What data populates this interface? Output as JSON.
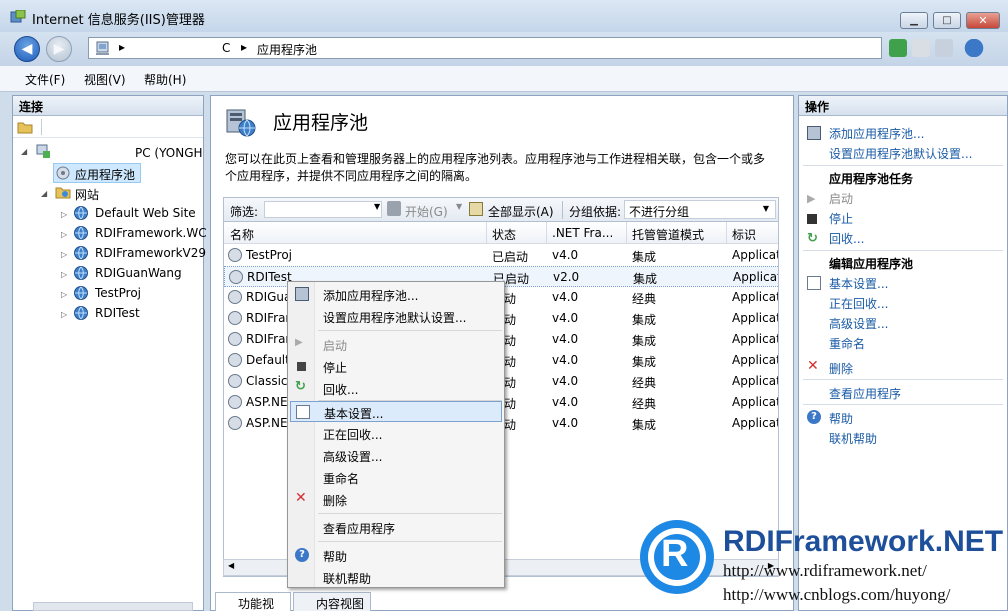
{
  "window": {
    "title": "Internet 信息服务(IIS)管理器",
    "minimize": "▁",
    "maximize": "□",
    "close": "✕"
  },
  "address": {
    "arrow": "▸",
    "segment_c": "C",
    "page": "应用程序池"
  },
  "menu": [
    "文件(F)",
    "视图(V)",
    "帮助(H)"
  ],
  "connections": {
    "header": "连接",
    "server": "PC (YONGH",
    "app_pools": "应用程序池",
    "sites": "网站",
    "site_items": [
      "Default Web Site",
      "RDIFramework.WC",
      "RDIFrameworkV29",
      "RDIGuanWang",
      "TestProj",
      "RDITest"
    ]
  },
  "main": {
    "title": "应用程序池",
    "description": "您可以在此页上查看和管理服务器上的应用程序池列表。应用程序池与工作进程相关联，包含一个或多个应用程序，并提供不同应用程序之间的隔离。",
    "filter_label": "筛选:",
    "start_btn": "开始(G)",
    "show_all": "全部显示(A)",
    "group_label": "分组依据:",
    "group_value": "不进行分组",
    "columns": [
      "名称",
      "状态",
      ".NET Fra...",
      "托管管道模式",
      "标识"
    ],
    "rows": [
      [
        "TestProj",
        "已启动",
        "v4.0",
        "集成",
        "Applicat"
      ],
      [
        "RDITest",
        "已启动",
        "v2.0",
        "集成",
        "Applicat"
      ],
      [
        "RDIGua",
        "启动",
        "v4.0",
        "经典",
        "Applicat"
      ],
      [
        "RDIFrar",
        "启动",
        "v4.0",
        "集成",
        "Applicat"
      ],
      [
        "RDIFrar",
        "启动",
        "v4.0",
        "集成",
        "Applicat"
      ],
      [
        "Default",
        "启动",
        "v4.0",
        "集成",
        "Applicat"
      ],
      [
        "Classic",
        "启动",
        "v4.0",
        "经典",
        "Applicat"
      ],
      [
        "ASP.NE",
        "启动",
        "v4.0",
        "经典",
        "Applicat"
      ],
      [
        "ASP.NE",
        "启动",
        "v4.0",
        "集成",
        "Applicat"
      ]
    ],
    "tab_feature": "功能视图",
    "tab_content": "内容视图"
  },
  "context_menu": {
    "items": [
      "添加应用程序池...",
      "设置应用程序池默认设置...",
      "启动",
      "停止",
      "回收...",
      "基本设置...",
      "正在回收...",
      "高级设置...",
      "重命名",
      "删除",
      "查看应用程序",
      "帮助",
      "联机帮助"
    ]
  },
  "actions": {
    "header": "操作",
    "add_pool": "添加应用程序池...",
    "set_defaults": "设置应用程序池默认设置...",
    "tasks_head": "应用程序池任务",
    "start": "启动",
    "stop": "停止",
    "recycle": "回收...",
    "edit_head": "编辑应用程序池",
    "basic": "基本设置...",
    "recycling": "正在回收...",
    "advanced": "高级设置...",
    "rename": "重命名",
    "delete": "删除",
    "view_apps": "查看应用程序",
    "help": "帮助",
    "online_help": "联机帮助"
  },
  "logo": {
    "letter": "R",
    "name": "RDIFramework.NET",
    "url1": "http://www.rdiframework.net/",
    "url2": "http://www.cnblogs.com/huyong/"
  },
  "colors": {
    "accent": "#1a5ba6",
    "selection": "#cde8ff",
    "logo_blue": "#1e88e5"
  }
}
